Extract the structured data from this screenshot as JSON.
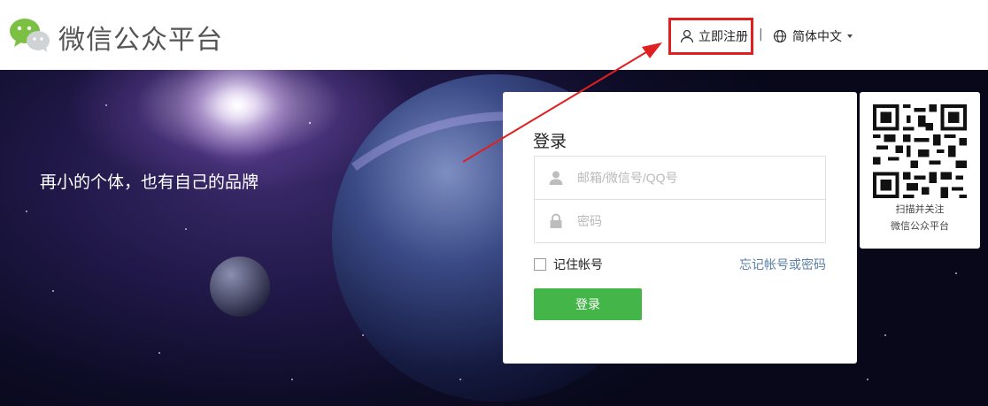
{
  "header": {
    "brand": "微信公众平台",
    "register_label": "立即注册",
    "separator": "|",
    "language_label": "简体中文"
  },
  "banner": {
    "tagline": "再小的个体，也有自己的品牌"
  },
  "login": {
    "title": "登录",
    "account_placeholder": "邮箱/微信号/QQ号",
    "password_placeholder": "密码",
    "remember_label": "记住帐号",
    "forgot_label": "忘记帐号或密码",
    "submit_label": "登录"
  },
  "qr": {
    "line1": "扫描并关注",
    "line2": "微信公众平台"
  },
  "colors": {
    "accent_green": "#44b549",
    "annotation_red": "#e02020",
    "link_blue": "#5b7fa6"
  }
}
